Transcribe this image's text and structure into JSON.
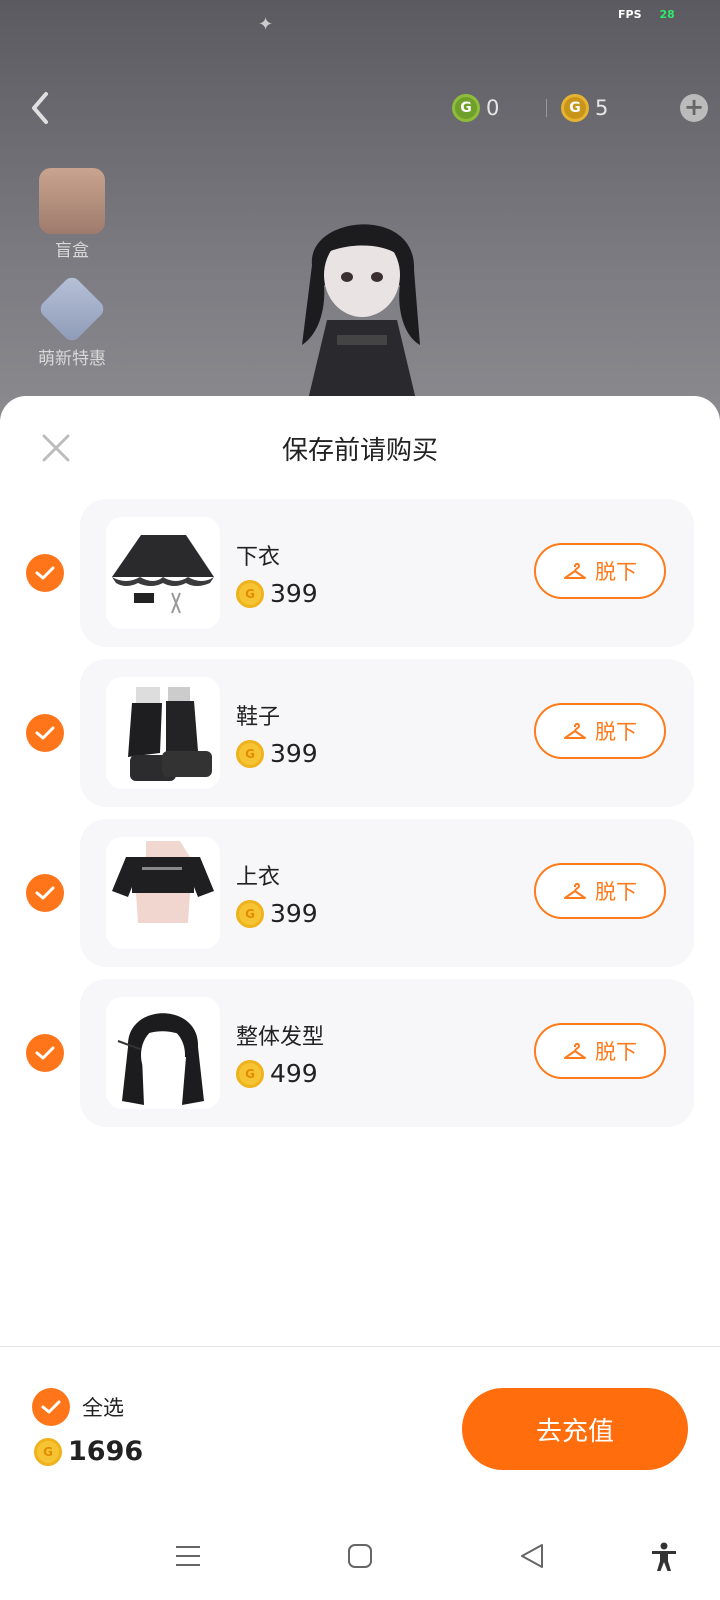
{
  "status": {
    "fps_label": "FPS",
    "fps_value": "28"
  },
  "currency": {
    "green_value": "0",
    "gold_value": "5"
  },
  "side_buttons": [
    {
      "label": "盲盒",
      "icon": "gift-box-icon"
    },
    {
      "label": "萌新特惠",
      "icon": "newbie-deal-icon"
    }
  ],
  "sheet": {
    "title": "保存前请购买"
  },
  "items": [
    {
      "name": "下衣",
      "price": "399",
      "action": "脱下",
      "checked": true,
      "thumb": "skirt"
    },
    {
      "name": "鞋子",
      "price": "399",
      "action": "脱下",
      "checked": true,
      "thumb": "boots"
    },
    {
      "name": "上衣",
      "price": "399",
      "action": "脱下",
      "checked": true,
      "thumb": "top"
    },
    {
      "name": "整体发型",
      "price": "499",
      "action": "脱下",
      "checked": true,
      "thumb": "hair"
    }
  ],
  "footer": {
    "select_all_label": "全选",
    "total": "1696",
    "recharge_label": "去充值"
  },
  "colors": {
    "accent": "#ff6d0c",
    "coin": "#f6c433"
  }
}
